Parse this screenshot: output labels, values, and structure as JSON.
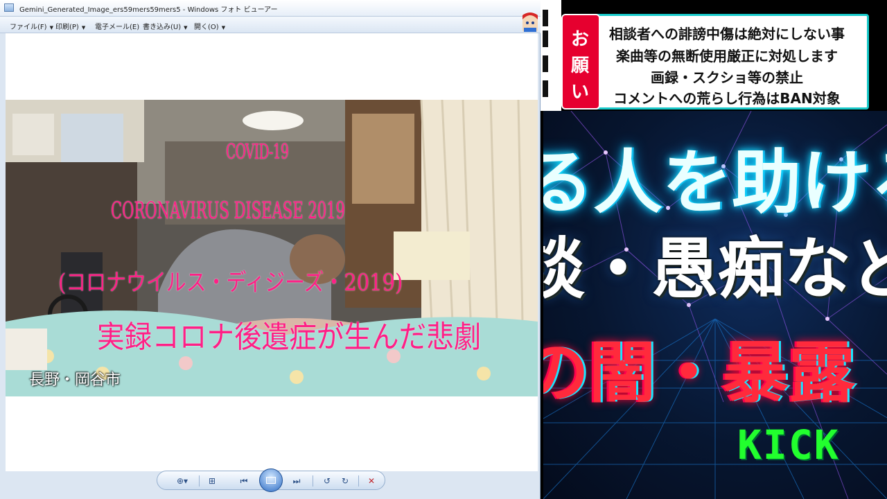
{
  "window": {
    "title": "Gemini_Generated_Image_ers59mers59mers5 - Windows フォト ビューアー"
  },
  "menu": {
    "items": [
      {
        "label": "ファイル(F)"
      },
      {
        "label": "印刷(P)"
      },
      {
        "label": "電子メール(E)"
      },
      {
        "label": "書き込み(U)"
      },
      {
        "label": "開く(O)"
      }
    ]
  },
  "photo": {
    "overlay_line1": "COVID-19",
    "overlay_line2": "CORONAVIRUS DISEASE 2019",
    "overlay_line3": "(コロナウイルス・ディジーズ・2019)",
    "overlay_line4": "実録コロナ後遺症が生んだ悲劇",
    "location": "長野・岡谷市"
  },
  "toolbar": {
    "zoom": "⊕▾",
    "fit": "⊞",
    "prev": "⏮",
    "next": "⏭",
    "rotate_left": "↺",
    "rotate_right": "↻",
    "delete": "✕"
  },
  "notice": {
    "badge": [
      "お",
      "願",
      "い"
    ],
    "rules": [
      "相談者への誹謗中傷は絶対にしない事",
      "楽曲等の無断使用厳正に対処します",
      "画録・スクショ等の禁止",
      "コメントへの荒らし行為はBAN対象"
    ]
  },
  "stream": {
    "line1": "る人を助ける",
    "line2": "談・愚痴など",
    "line3": "の闇・暴露",
    "kick": "KICK"
  },
  "colors": {
    "overlay_text": "#ff1f86",
    "notice_border": "#17c9c9",
    "badge_red": "#e6002f",
    "kick_green": "#22ff2e"
  }
}
